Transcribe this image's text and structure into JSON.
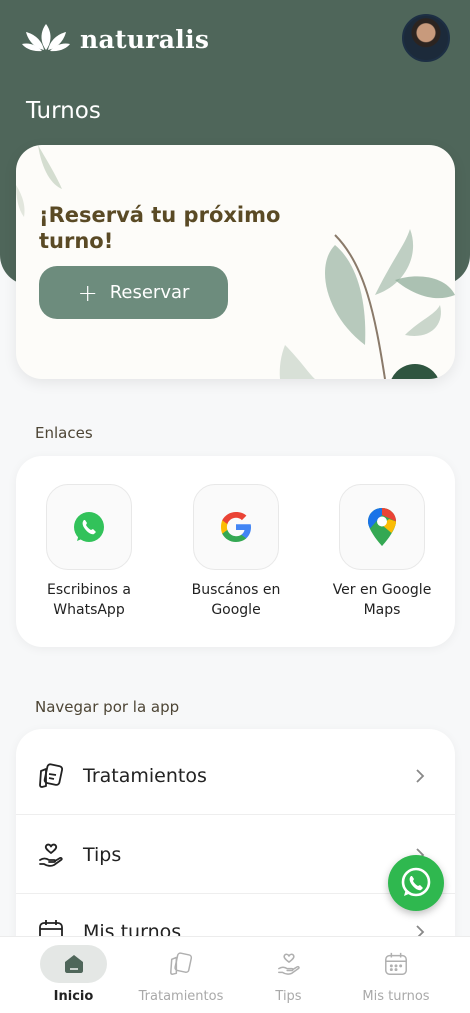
{
  "app": {
    "brand": "naturalis",
    "page_title": "Turnos"
  },
  "hero": {
    "title": "¡Reservá tu próximo turno!",
    "button_label": "Reservar"
  },
  "links": {
    "section_title": "Enlaces",
    "items": [
      {
        "label": "Escribinos a WhatsApp",
        "icon": "whatsapp-icon"
      },
      {
        "label": "Buscános en Google",
        "icon": "google-icon"
      },
      {
        "label": "Ver en Google Maps",
        "icon": "google-maps-icon"
      }
    ]
  },
  "navigation": {
    "section_title": "Navegar por la app",
    "items": [
      {
        "label": "Tratamientos",
        "icon": "treatments-icon"
      },
      {
        "label": "Tips",
        "icon": "tips-icon"
      },
      {
        "label": "Mis turnos",
        "icon": "calendar-icon"
      }
    ]
  },
  "tabs": [
    {
      "label": "Inicio",
      "icon": "home-icon",
      "active": true
    },
    {
      "label": "Tratamientos",
      "icon": "treatments-icon",
      "active": false
    },
    {
      "label": "Tips",
      "icon": "tips-icon",
      "active": false
    },
    {
      "label": "Mis turnos",
      "icon": "calendar-icon",
      "active": false
    }
  ],
  "colors": {
    "header": "#4f665a",
    "accent_button": "#6d8c7d",
    "hero_title": "#5a4a25",
    "whatsapp": "#2fb84f"
  }
}
